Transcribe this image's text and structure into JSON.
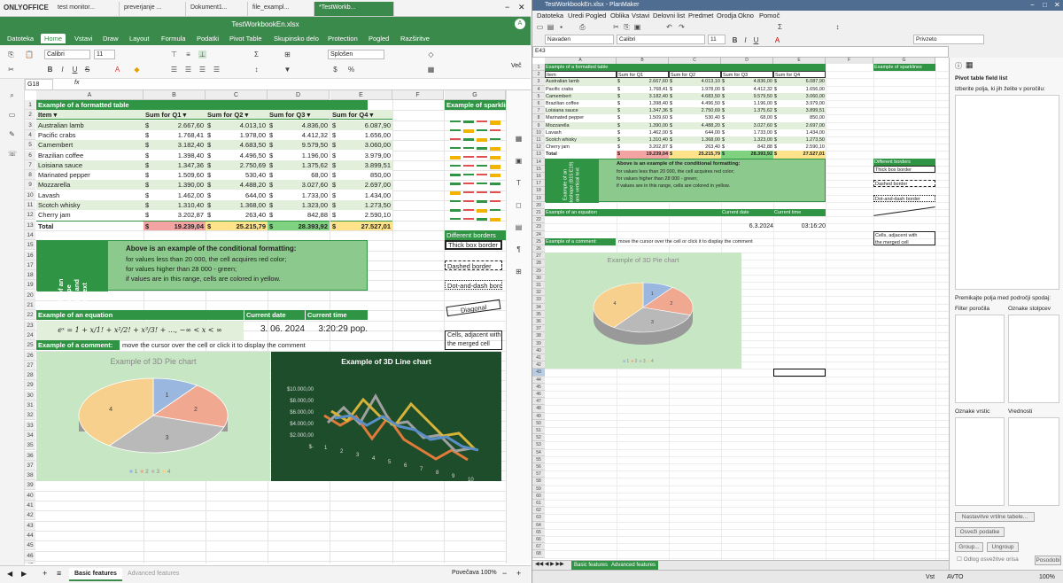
{
  "left": {
    "brand": "ONLYOFFICE",
    "tabs": [
      "test monitor...",
      "preverjanje ...",
      "Dokument1...",
      "file_exampl...",
      "*TestWorkb..."
    ],
    "title": "TestWorkbookEn.xlsx",
    "menu": [
      "Datoteka",
      "Home",
      "Vstavi",
      "Draw",
      "Layout",
      "Formula",
      "Podatki",
      "Pivot Table",
      "Skupinsko delo",
      "Protection",
      "Pogled",
      "Razširitve"
    ],
    "font": "Calibri",
    "font_size": "11",
    "number_format": "Splošen",
    "more_label": "Več",
    "cell_ref": "G18",
    "fx": "fx",
    "columns": [
      "A",
      "B",
      "C",
      "D",
      "E",
      "F",
      "G"
    ],
    "rows": [
      "1",
      "2",
      "3",
      "4",
      "5",
      "6",
      "7",
      "8",
      "9",
      "10",
      "11",
      "12",
      "13",
      "14",
      "15",
      "16",
      "17",
      "18",
      "19",
      "20",
      "21",
      "22",
      "23",
      "24",
      "25",
      "26",
      "27",
      "28",
      "29",
      "30",
      "31",
      "32",
      "33",
      "34",
      "35",
      "36",
      "37",
      "38",
      "39",
      "40",
      "41",
      "42",
      "43",
      "44",
      "45",
      "46",
      "47"
    ],
    "table_title": "Example of a formatted table",
    "headers": [
      "Item",
      "Sum for Q1",
      "Sum for Q2",
      "Sum for Q3",
      "Sum for Q4"
    ],
    "items": [
      [
        "Australian lamb",
        "2.667,60",
        "4.013,10",
        "4.836,00",
        "6.087,90"
      ],
      [
        "Pacific crabs",
        "1.768,41",
        "1.978,00",
        "4.412,32",
        "1.656,00"
      ],
      [
        "Camembert",
        "3.182,40",
        "4.683,50",
        "9.579,50",
        "3.060,00"
      ],
      [
        "Brazilian coffee",
        "1.398,40",
        "4.496,50",
        "1.196,00",
        "3.979,00"
      ],
      [
        "Loisiana sauce",
        "1.347,36",
        "2.750,69",
        "1.375,62",
        "3.899,51"
      ],
      [
        "Marinated pepper",
        "1.509,60",
        "530,40",
        "68,00",
        "850,00"
      ],
      [
        "Mozzarella",
        "1.390,00",
        "4.488,20",
        "3.027,60",
        "2.697,00"
      ],
      [
        "Lavash",
        "1.462,00",
        "644,00",
        "1.733,00",
        "1.434,00"
      ],
      [
        "Scotch whisky",
        "1.310,40",
        "1.368,00",
        "1.323,00",
        "1.273,50"
      ],
      [
        "Cherry jam",
        "3.202,87",
        "263,40",
        "842,88",
        "2.590,10"
      ]
    ],
    "total": [
      "Total",
      "19.239,04",
      "25.215,79",
      "28.393,92",
      "27.527,01"
    ],
    "currency": "$",
    "sparklines_title": "Example of sparklines",
    "autoshape_text": "Example of an autoshape (B15:E19) and vertical text",
    "cond_title": "Above is an example of the conditional formatting:",
    "cond_lines": [
      "for values less than 20 000, the cell acquires red color;",
      "for values higher than 28 000 - green;",
      "if values are in this range, cells are colored in yellow."
    ],
    "borders_title": "Different borders",
    "borders": [
      "Thick box border",
      "Dashed border",
      "Dot-and-dash border",
      "Diagonal",
      "Cells, adjacent with",
      "the merged cell"
    ],
    "equation_title": "Example of an equation",
    "equation": "eˣ = 1 + x/1! + x²/2! + x³/3! + ..., −∞ < x < ∞",
    "current_date_label": "Current date",
    "current_time_label": "Current time",
    "current_date": "3. 06. 2024",
    "current_time": "3:20:29 pop.",
    "comment_title": "Example of a comment:",
    "comment_text": "move the cursor over the cell or click it to display the comment",
    "pie_title": "Example of 3D Pie chart",
    "pie_labels": [
      "1",
      "2",
      "3",
      "4"
    ],
    "line_title": "Example of 3D Line chart",
    "line_yticks": [
      "$10.000,00",
      "$8.000,00",
      "$6.000,00",
      "$4.000,00",
      "$2.000,00",
      "$-"
    ],
    "line_xticks": [
      "1",
      "2",
      "3",
      "4",
      "5",
      "6",
      "7",
      "8",
      "9",
      "10"
    ],
    "sheets": [
      "Basic features",
      "Advanced features"
    ],
    "zoom": "Povečava 100%"
  },
  "right": {
    "title": "TestWorkbookEn.xlsx - PlanMaker",
    "menu": [
      "Datoteka",
      "Uredi",
      "Pogled",
      "Oblika",
      "Vstavi",
      "Delovni list",
      "Predmet",
      "Orodja",
      "Okno",
      "Pomoč"
    ],
    "style": "Navaden",
    "font": "Calibri",
    "size": "11",
    "default": "Privzeto",
    "cell_ref": "E43",
    "columns": [
      "A",
      "B",
      "C",
      "D",
      "E",
      "F",
      "G"
    ],
    "current_date": "6.3.2024",
    "current_time": "03:16:20",
    "pivot_title": "Pivot table field list",
    "pivot_sub": "Izberite polja, ki jih želite v poročilu:",
    "pivot_drag": "Premikajte polja med področji spodaj:",
    "areas": [
      "Filter poročila",
      "Oznake stolpcev",
      "Oznake vrstic",
      "Vrednosti"
    ],
    "buttons": [
      "Nastavitve vrtilne tabele...",
      "Osveži podatke",
      "Group...",
      "Ungroup",
      "Posodobi"
    ],
    "defer": "Odlog osvežitve orisa",
    "sheets": [
      "Basic features",
      "Advanced features"
    ],
    "status": [
      "Vst",
      "AVTO",
      "100%"
    ]
  }
}
